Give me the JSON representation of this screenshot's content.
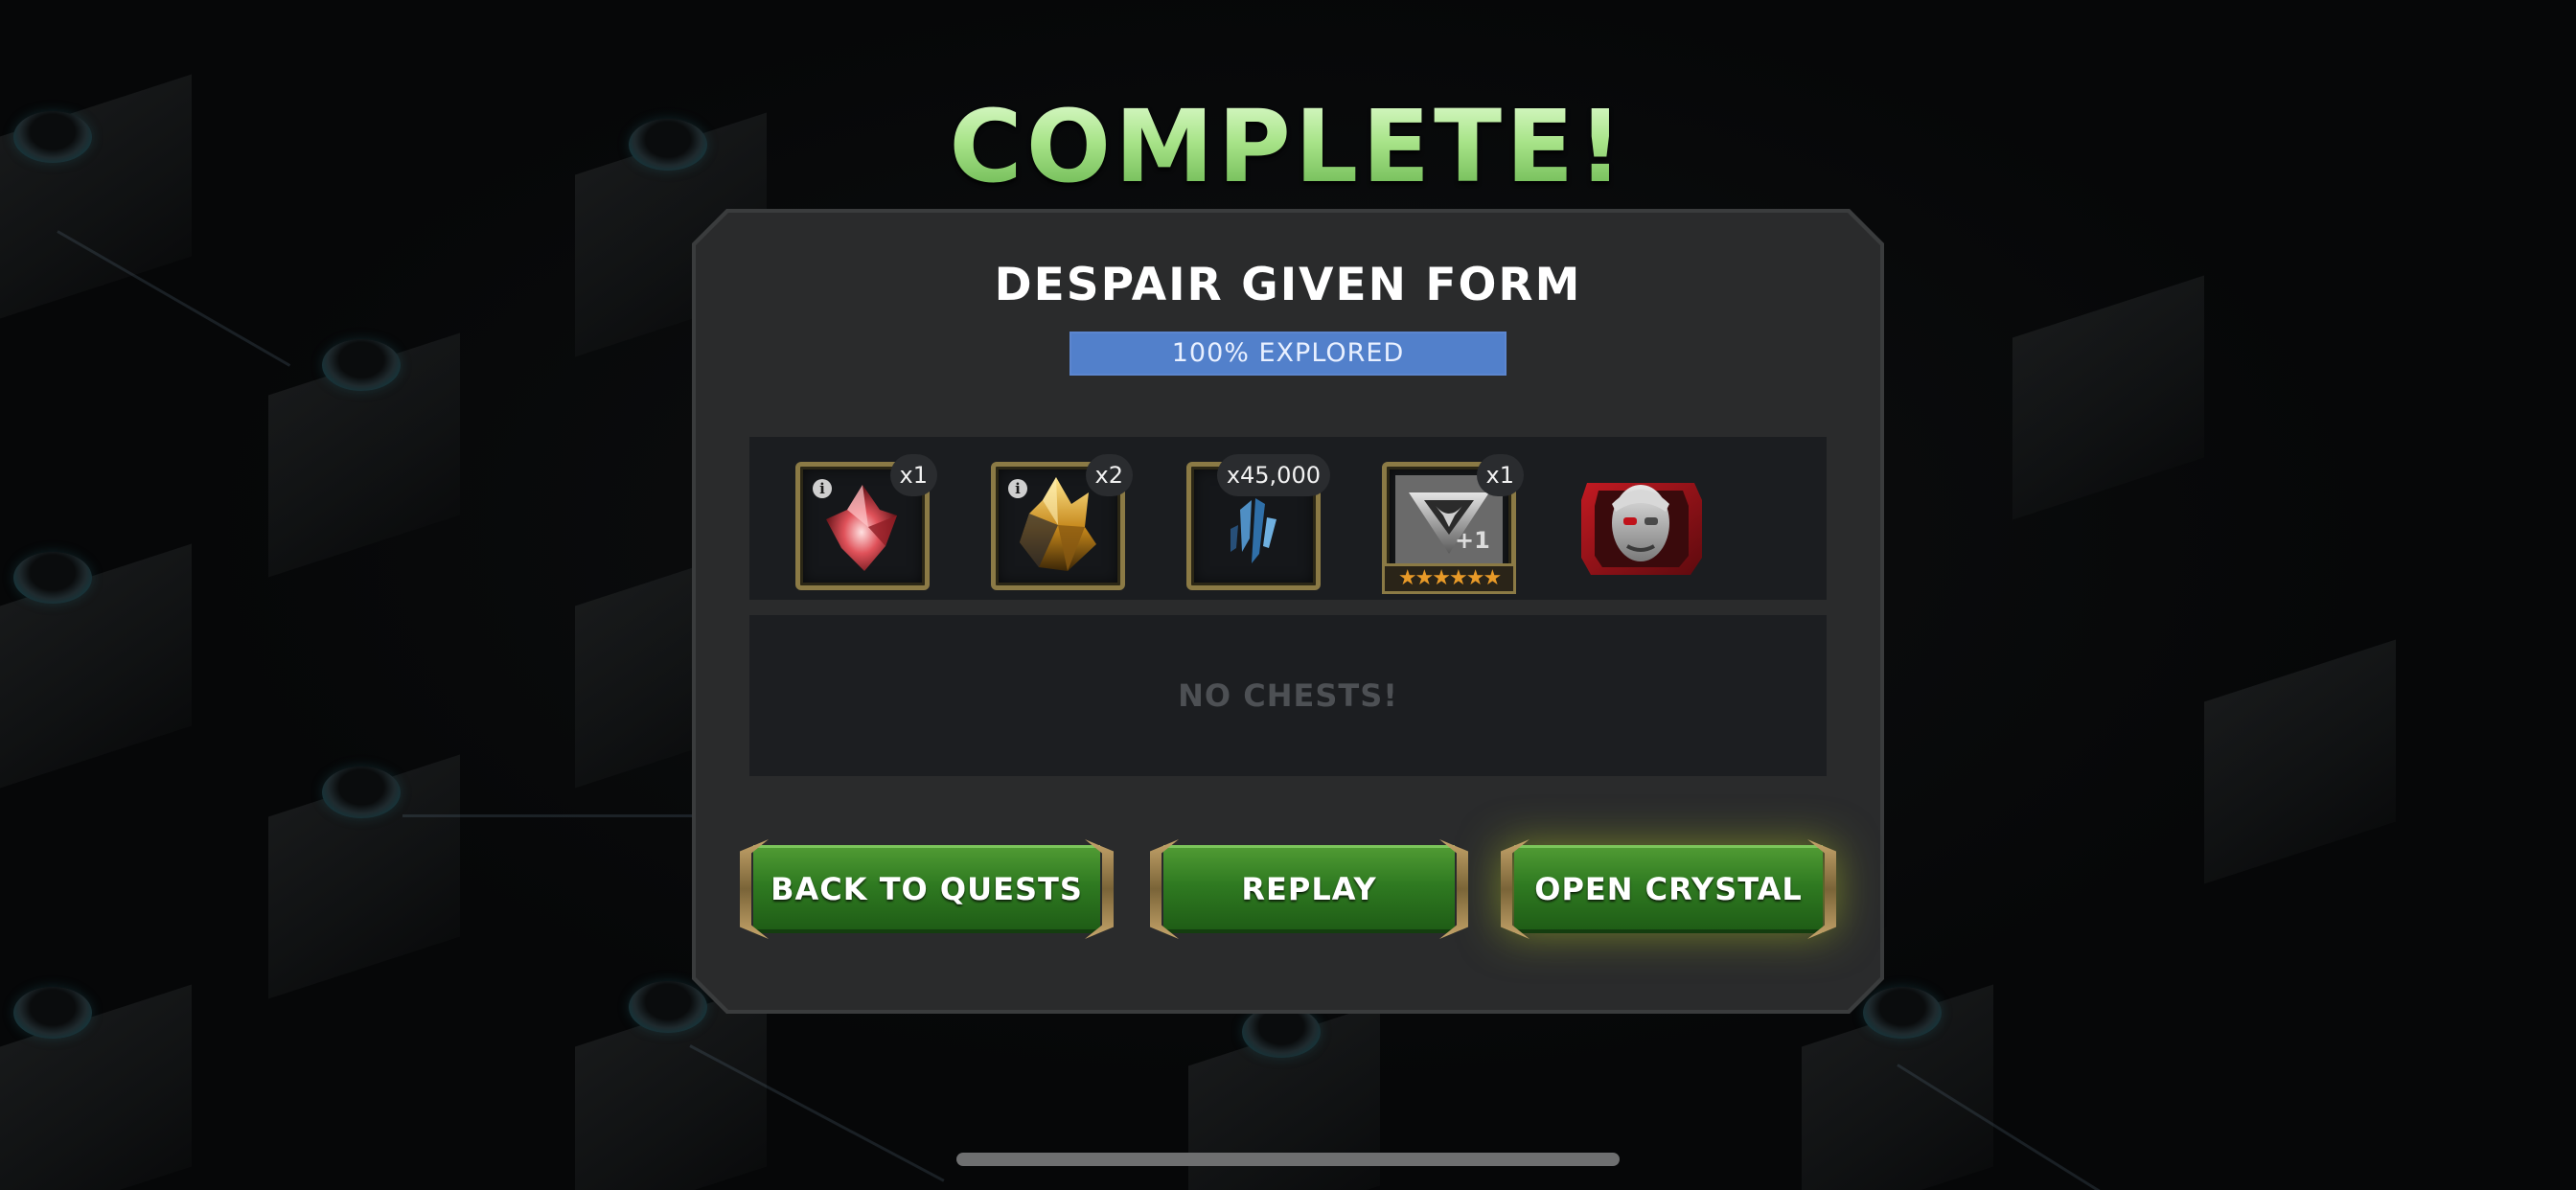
{
  "screen_title": "COMPLETE!",
  "quest": {
    "name": "DESPAIR GIVEN FORM",
    "explored_label": "100% EXPLORED",
    "explored_fraction": 1.0
  },
  "rewards": [
    {
      "name": "red-crystal-shard-icon",
      "quantity": "x1",
      "has_info": true
    },
    {
      "name": "gold-crystal-icon",
      "quantity": "x2",
      "has_info": true
    },
    {
      "name": "blue-shard-icon",
      "quantity": "x45,000",
      "has_info": false
    },
    {
      "name": "rank-up-item-icon",
      "quantity": "x1",
      "has_info": false,
      "stars": "★★★★★★",
      "plus": "+1"
    },
    {
      "name": "champion-portrait-icon",
      "quantity": "",
      "has_info": false
    }
  ],
  "chests": {
    "empty_label": "NO CHESTS!"
  },
  "buttons": {
    "back": "BACK TO QUESTS",
    "replay": "REPLAY",
    "open_crystal": "OPEN CRYSTAL"
  },
  "colors": {
    "title_green": "#9fdc7a",
    "explored_blue": "#5280cb",
    "button_green": "#2f7a21",
    "frame_gold": "#8b7a45"
  }
}
